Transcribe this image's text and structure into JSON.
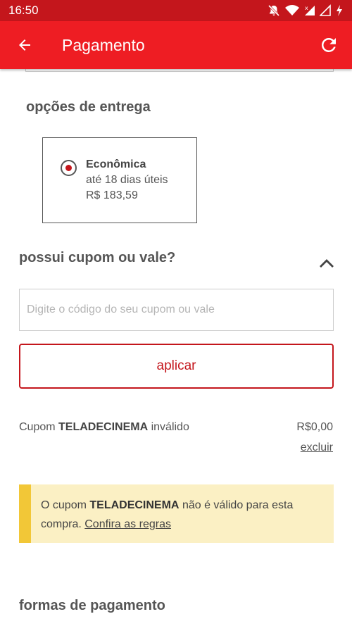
{
  "status_bar": {
    "time": "16:50",
    "icons": [
      "mute-notification-icon",
      "wifi-icon",
      "cellular-signal-icon",
      "no-signal-icon",
      "battery-charging-icon"
    ]
  },
  "app_bar": {
    "title": "Pagamento",
    "back_icon": "arrow-left-icon",
    "refresh_icon": "refresh-icon"
  },
  "delivery": {
    "section_title": "opções de entrega",
    "option": {
      "name": "Econômica",
      "eta": "até 18 dias úteis",
      "price": "R$ 183,59",
      "selected": true
    }
  },
  "coupon": {
    "section_title": "possui cupom ou vale?",
    "expanded": true,
    "input_value": "",
    "input_placeholder": "Digite o código do seu cupom ou vale",
    "apply_label": "aplicar",
    "status": {
      "prefix": "Cupom",
      "code": "TELADECINEMA",
      "suffix": "inválido",
      "value": "R$0,00",
      "remove_label": "excluir"
    },
    "alert": {
      "prefix": "O cupom",
      "code": "TELADECINEMA",
      "text": "não é válido para esta compra.",
      "link_label": "Confira as regras"
    }
  },
  "payment": {
    "section_title": "formas de pagamento"
  },
  "colors": {
    "status_bar": "#c4161c",
    "app_bar": "#ee1d23",
    "accent": "#c4161c",
    "alert_background": "#fbf0c4",
    "alert_stripe": "#f2c737"
  }
}
